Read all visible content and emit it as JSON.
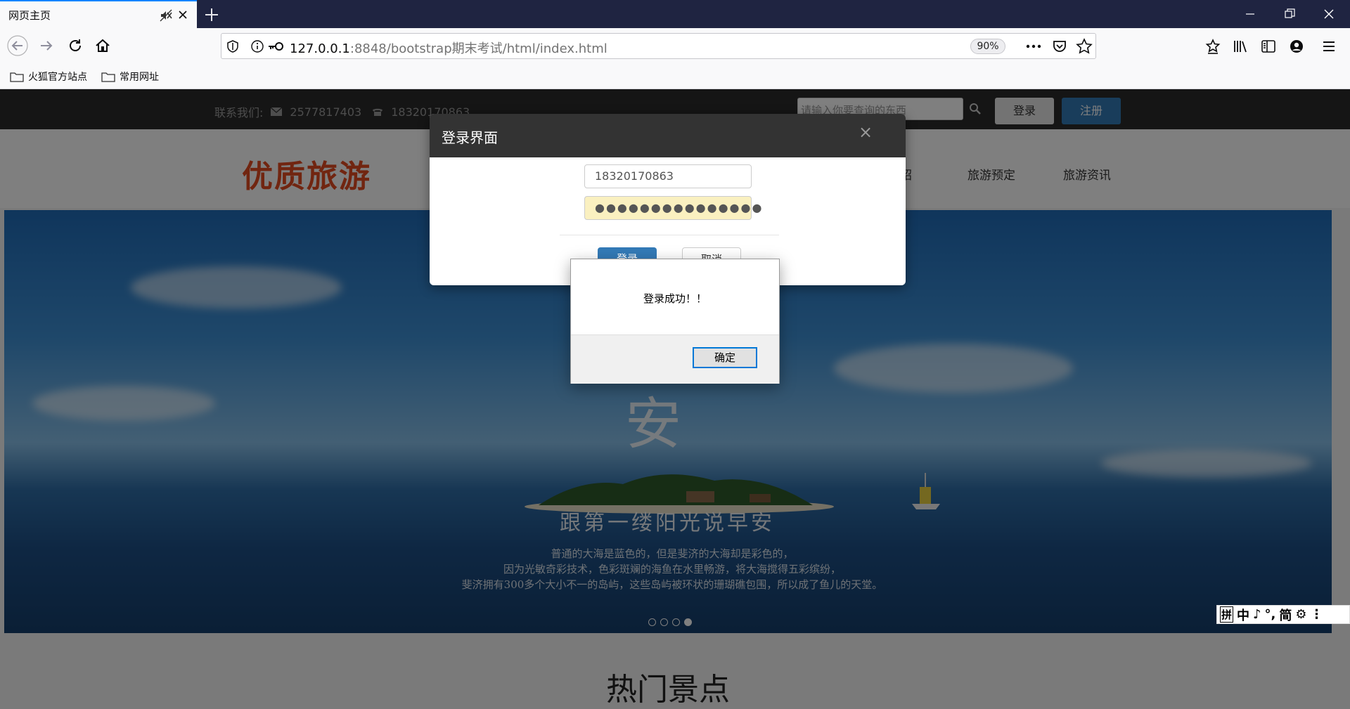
{
  "browser": {
    "tab_title": "网页主页",
    "url_host": "127.0.0.1",
    "url_rest": ":8848/bootstrap期末考试/html/index.html",
    "zoom": "90%",
    "bookmarks": [
      "火狐官方站点",
      "常用网址"
    ]
  },
  "site": {
    "contact_label": "联系我们:",
    "email": "2577817403",
    "phone": "18320170863",
    "search_placeholder": "请输入你要查询的东西",
    "login_button": "登录",
    "register_button": "注册",
    "logo": "优质旅游",
    "nav": [
      "绍",
      "旅游预定",
      "旅游资讯"
    ],
    "hero_char": "安",
    "hero_tagline": "跟第一缕阳光说早安",
    "hero_desc": [
      "普通的大海是蓝色的，但是斐济的大海却是彩色的，",
      "因为光敏奇彩技术，色彩斑斓的海鱼在水里畅游，将大海搅得五彩缤纷，",
      "斐济拥有300多个大小不一的岛屿，这些岛屿被环状的珊瑚礁包围，所以成了鱼儿的天堂。"
    ],
    "carousel_active": 4,
    "carousel_count": 4,
    "section_title": "热门景点"
  },
  "login_modal": {
    "title": "登录界面",
    "close_symbol": "×",
    "username_value": "18320170863",
    "password_masked": "●●●●●●●●●●●●●●●",
    "ok_label": "登录",
    "cancel_label": "取消"
  },
  "alert": {
    "message": "登录成功！！",
    "ok_label": "确定"
  },
  "ime": {
    "items": [
      "拼",
      "中",
      "♪",
      "°,",
      "简",
      "⚙",
      "⋮"
    ]
  },
  "colors": {
    "tabbar": "#1f2441",
    "accent": "#0a84ff",
    "logo": "#e24a20",
    "primary_button": "#337ab7"
  }
}
